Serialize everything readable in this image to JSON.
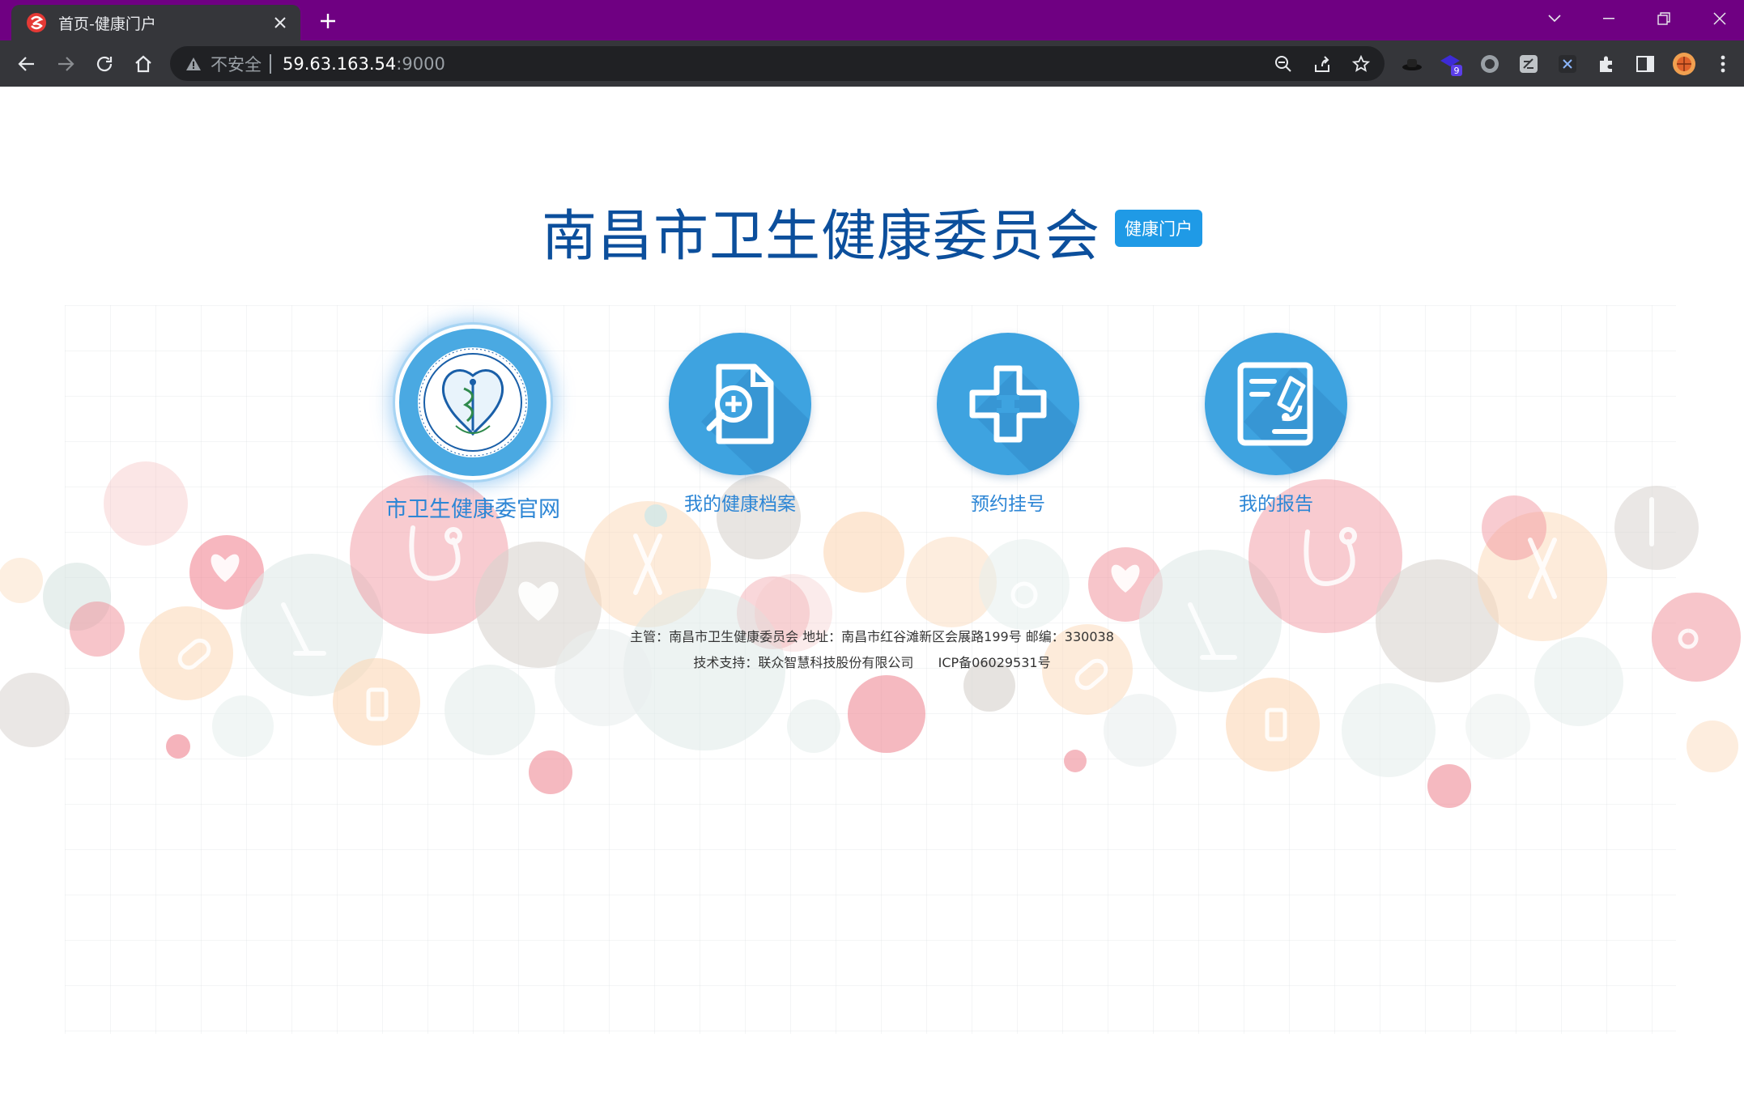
{
  "browser": {
    "tab_title": "首页-健康门户",
    "security_label": "不安全",
    "url_host": "59.63.163.54",
    "url_port": ":9000",
    "extension_badge": "9"
  },
  "site": {
    "title": "南昌市卫生健康委员会",
    "badge": "健康门户",
    "items": [
      {
        "label": "市卫生健康委官网",
        "icon": "commission-logo-icon"
      },
      {
        "label": "我的健康档案",
        "icon": "health-record-icon"
      },
      {
        "label": "预约挂号",
        "icon": "medical-cross-icon"
      },
      {
        "label": "我的报告",
        "icon": "report-microscope-icon"
      }
    ],
    "footer": {
      "line1": "主管：南昌市卫生健康委员会 地址：南昌市红谷滩新区会展路199号 邮编：330038",
      "support": "技术支持：联众智慧科技股份有限公司",
      "icp": "ICP备06029531号"
    }
  },
  "colors": {
    "tabbar": "#6f0082",
    "toolbar": "#35363a",
    "title": "#0c4f9c",
    "badge": "#1f9ae6",
    "icon_circle": "#3ea3e0",
    "label": "#2d86d5"
  }
}
